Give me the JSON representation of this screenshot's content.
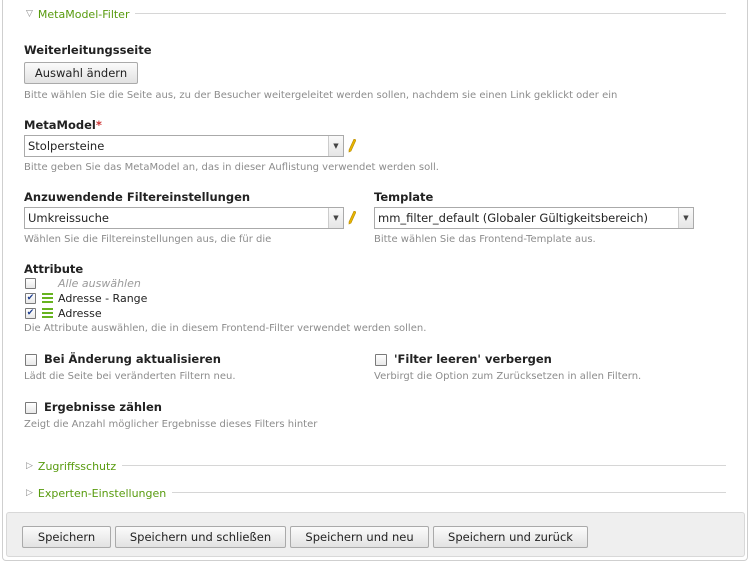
{
  "sections": {
    "metamodel_filter": "MetaModel-Filter",
    "zugriffsschutz": "Zugriffsschutz",
    "experten": "Experten-Einstellungen"
  },
  "redirect": {
    "label": "Weiterleitungsseite",
    "button": "Auswahl ändern",
    "help": "Bitte wählen Sie die Seite aus, zu der Besucher weitergeleitet werden sollen, nachdem sie einen Link geklickt oder ein"
  },
  "metamodel": {
    "label": "MetaModel",
    "required_mark": "*",
    "value": "Stolpersteine",
    "help": "Bitte geben Sie das MetaModel an, das in dieser Auflistung verwendet werden soll."
  },
  "filter_settings": {
    "label": "Anzuwendende Filtereinstellungen",
    "value": "Umkreissuche",
    "help": "Wählen Sie die Filtereinstellungen aus, die für die"
  },
  "template": {
    "label": "Template",
    "value": "mm_filter_default (Globaler Gültigkeitsbereich)",
    "help": "Bitte wählen Sie das Frontend-Template aus."
  },
  "attributes": {
    "label": "Attribute",
    "select_all": "Alle auswählen",
    "items": [
      {
        "label": "Adresse - Range",
        "checked": true
      },
      {
        "label": "Adresse",
        "checked": true
      }
    ],
    "help": "Die Attribute auswählen, die in diesem Frontend-Filter verwendet werden sollen."
  },
  "on_change": {
    "label": "Bei Änderung aktualisieren",
    "help": "Lädt die Seite bei veränderten Filtern neu.",
    "checked": false
  },
  "hide_clear": {
    "label": "'Filter leeren' verbergen",
    "help": "Verbirgt die Option zum Zurücksetzen in allen Filtern.",
    "checked": false
  },
  "count_results": {
    "label": "Ergebnisse zählen",
    "help": "Zeigt die Anzahl möglicher Ergebnisse dieses Filters hinter",
    "checked": false
  },
  "footer": {
    "save": "Speichern",
    "save_close": "Speichern und schließen",
    "save_new": "Speichern und neu",
    "save_back": "Speichern und zurück"
  },
  "colors": {
    "legend_green": "#589b0e",
    "required_red": "#cc3333",
    "wizard_yellow": "#e8b500"
  },
  "icons": {
    "legend_open": "triangle-down-icon",
    "legend_closed": "triangle-right-icon",
    "wizard": "pencil-wizard-icon",
    "drag": "drag-handle-icon"
  }
}
